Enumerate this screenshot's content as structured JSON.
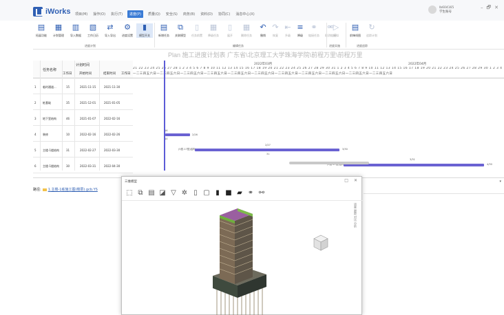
{
  "app": {
    "name": "iWorks",
    "menu": [
      "项目(M)",
      "操作(O)",
      "执行(T)",
      "进度(P)",
      "质量(Q)",
      "安全(S)",
      "商务(B)",
      "资料(D)",
      "协同(C)",
      "消息中心(X)"
    ],
    "active_menu_index": 3,
    "user": {
      "id": "lb604165",
      "role": "学生账号"
    },
    "window_controls": [
      "–",
      "🗗",
      "✕"
    ]
  },
  "ribbon": {
    "groups": [
      {
        "name": "进度计划",
        "buttons": [
          {
            "label": "拓展功能",
            "icon": "save-icon"
          },
          {
            "label": "计划管理",
            "icon": "calendar-icon"
          },
          {
            "label": "导入数据",
            "icon": "import-icon"
          },
          {
            "label": "工作日历",
            "icon": "calendar-grid-icon"
          },
          {
            "label": "导入导出",
            "icon": "transfer-icon"
          },
          {
            "label": "进度设置",
            "icon": "gear-icon"
          },
          {
            "label": "模型开关",
            "icon": "building-icon"
          }
        ]
      },
      {
        "name": "编辑任务",
        "buttons": [
          {
            "label": "新增任务",
            "icon": "doc-add-icon"
          },
          {
            "label": "关联模型",
            "icon": "link-icon"
          },
          {
            "label": "任务前置",
            "icon": "doc-icon"
          },
          {
            "label": "降级任务",
            "icon": "grid-icon"
          },
          {
            "label": "展开",
            "icon": "doc-icon"
          },
          {
            "label": "删除任务",
            "icon": "grid-icon"
          },
          {
            "label": "撤销",
            "icon": "undo-icon"
          },
          {
            "label": "恢复",
            "icon": "redo-icon"
          },
          {
            "label": "升级",
            "icon": "outdent-icon"
          },
          {
            "label": "降级",
            "icon": "indent-icon"
          },
          {
            "label": "链接任务",
            "icon": "chain-icon"
          },
          {
            "label": "取消链接",
            "icon": "unlink-icon"
          }
        ]
      },
      {
        "name": "进度实施",
        "buttons": [
          {
            "label": "模拟",
            "icon": "play-icon"
          }
        ]
      },
      {
        "name": "进度追踪",
        "buttons": [
          {
            "label": "前锋线图",
            "icon": "chart-icon"
          },
          {
            "label": "追踪计划",
            "icon": "refresh-icon"
          }
        ]
      }
    ]
  },
  "plan_title": "Plan 施工进度计划表 广东省\\北京理工大学珠海学院\\前程万里\\前程万里",
  "table": {
    "headers": {
      "name": "任务名称",
      "plan_time": "计划时间",
      "work_days": "工作日",
      "start": "开始时间",
      "end": "结束时间",
      "extra": "工作日"
    },
    "rows": [
      {
        "index": "1",
        "name": "临时通道...",
        "days": "15",
        "start": "2021-11-15",
        "end": "2021-11-30"
      },
      {
        "index": "2",
        "name": "桩基础",
        "days": "35",
        "start": "2021-12-01",
        "end": "2021-01-05"
      },
      {
        "index": "3",
        "name": "地下室结构",
        "days": "46",
        "start": "2021-01-07",
        "end": "2022-02-16"
      },
      {
        "index": "4",
        "name": "装修",
        "days": "10",
        "start": "2022-02-16",
        "end": "2022-02-26"
      },
      {
        "index": "5",
        "name": "主楼-1楼结构",
        "days": "31",
        "start": "2022-02-27",
        "end": "2022-03-30"
      },
      {
        "index": "6",
        "name": "主楼-1楼结构",
        "days": "30",
        "start": "2022-03-31",
        "end": "2022-04-30"
      }
    ]
  },
  "gantt": {
    "months": [
      "2022年03月",
      "2022年04月"
    ],
    "days_row": "21 22 23 24 25 26 27 28 1 2 3 4 5 6 7 8 9 10 11 12 13 14 15 16 17 18 19 20 21 22 23 24 25 26 27 28 29 30 31 1 2 3 4 5 6 7 8 9 10 11 12 13 14 15 16 17 18 19 20 21 22 23 24 25 26 27 28 29 30 1 2 3 4",
    "weekday_row": "一二三四五六日一二三四五六日一二三四五六日一二三四五六日一二三四五六日一二三四五六日一二三四五六日一二三四五六日一二三四五六日一二三四五六日一二三四五六日",
    "bars": [
      {
        "row": 4,
        "start_label": "16",
        "end_label": "2/26",
        "sub": "10",
        "progress": null
      },
      {
        "row": 5,
        "start_label": "(5层-17层)结构",
        "end_label": "3/30",
        "sub": "31",
        "top": "2/27"
      },
      {
        "row": 6,
        "start_label": "(5层-17层)结构",
        "end_label": "4/30",
        "sub": "",
        "top": "3/31"
      }
    ]
  },
  "lower": {
    "path_prefix": "路径:",
    "path_link": "1.主楼-1栋施工图(楼层).gcb.YS",
    "collapse": "▾"
  },
  "model_window": {
    "title": "三维模型",
    "controls": [
      "□",
      "✕"
    ],
    "side_label": "进度 跟踪 对比 分析",
    "tools": [
      "select-icon",
      "select-box-icon",
      "layer-icon",
      "section-icon",
      "filter-icon",
      "measure-icon",
      "doc-icon",
      "frame-icon",
      "cube-dark-icon",
      "cube-solid-icon",
      "cube-fill-icon",
      "link-icon",
      "unlink-icon"
    ]
  }
}
